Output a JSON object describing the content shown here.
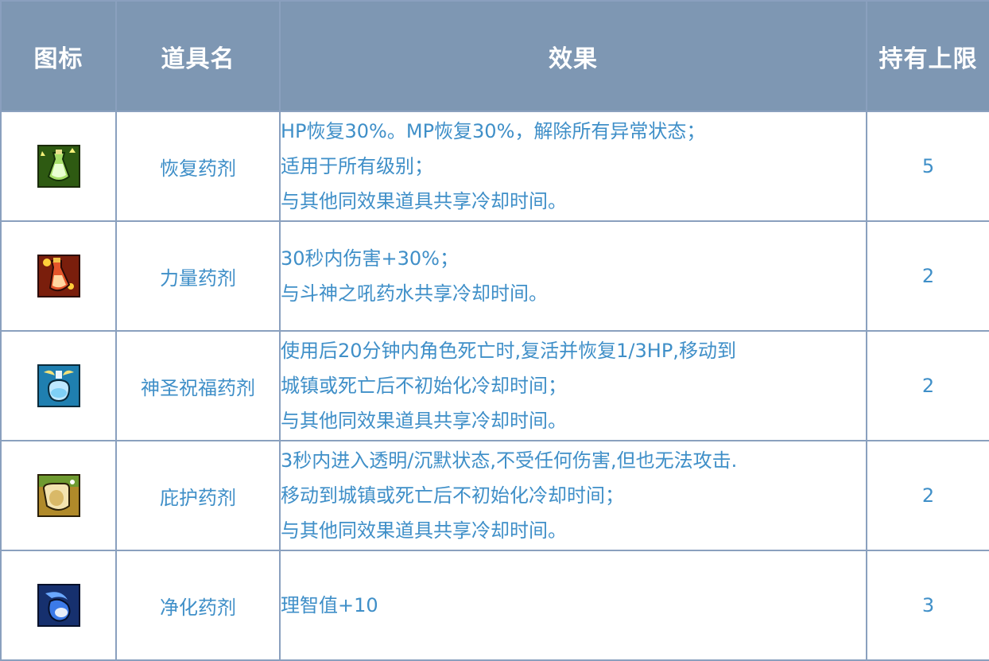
{
  "table": {
    "headers": {
      "icon": "图标",
      "name": "道具名",
      "effect": "效果",
      "limit": "持有上限"
    },
    "rows": [
      {
        "icon": "recovery-potion-icon",
        "name": "恢复药剂",
        "effect": [
          "HP恢复30%。MP恢复30%，解除所有异常状态；",
          "适用于所有级别；",
          "与其他同效果道具共享冷却时间。"
        ],
        "limit": "5"
      },
      {
        "icon": "power-potion-icon",
        "name": "力量药剂",
        "effect": [
          "30秒内伤害+30%；",
          "与斗神之吼药水共享冷却时间。"
        ],
        "limit": "2"
      },
      {
        "icon": "holy-blessing-potion-icon",
        "name": "神圣祝福药剂",
        "effect": [
          "使用后20分钟内角色死亡时,复活并恢复1/3HP,移动到",
          "城镇或死亡后不初始化冷却时间；",
          "与其他同效果道具共享冷却时间。"
        ],
        "limit": "2"
      },
      {
        "icon": "shelter-potion-icon",
        "name": "庇护药剂",
        "effect": [
          "3秒内进入透明/沉默状态,不受任何伤害,但也无法攻击.",
          "移动到城镇或死亡后不初始化冷却时间；",
          "与其他同效果道具共享冷却时间。"
        ],
        "limit": "2"
      },
      {
        "icon": "purification-potion-icon",
        "name": "净化药剂",
        "effect": [
          "理智值+10"
        ],
        "limit": "3"
      }
    ]
  },
  "colors": {
    "header_bg": "#7e97b3",
    "header_text": "#ffffff",
    "border": "#8aa0be",
    "cell_text": "#3f8fc8"
  }
}
